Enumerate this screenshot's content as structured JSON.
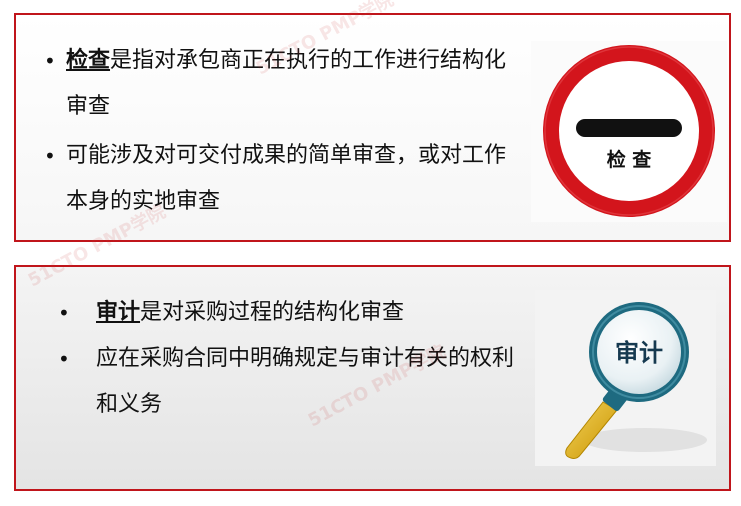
{
  "inspection": {
    "term": "检查",
    "bullet1_rest": "是指对承包商正在执行的工作进行结构化审查",
    "bullet2": "可能涉及对可交付成果的简单审查，或对工作本身的实地审查",
    "sign_text": "检  查"
  },
  "audit": {
    "term": "审计",
    "bullet1_rest": "是对采购过程的结构化审查",
    "bullet2": "应在采购合同中明确规定与审计有关的权利和义务",
    "icon_text": "审计"
  },
  "watermark": "51CTO PMP学院",
  "colors": {
    "border": "#c0151b",
    "sign_red": "#d3151c",
    "sign_bar": "#111111",
    "lens_rim": "#1e6a80",
    "handle": "#e6b318"
  },
  "icons": [
    "no-entry-sign-icon",
    "magnifier-icon"
  ]
}
